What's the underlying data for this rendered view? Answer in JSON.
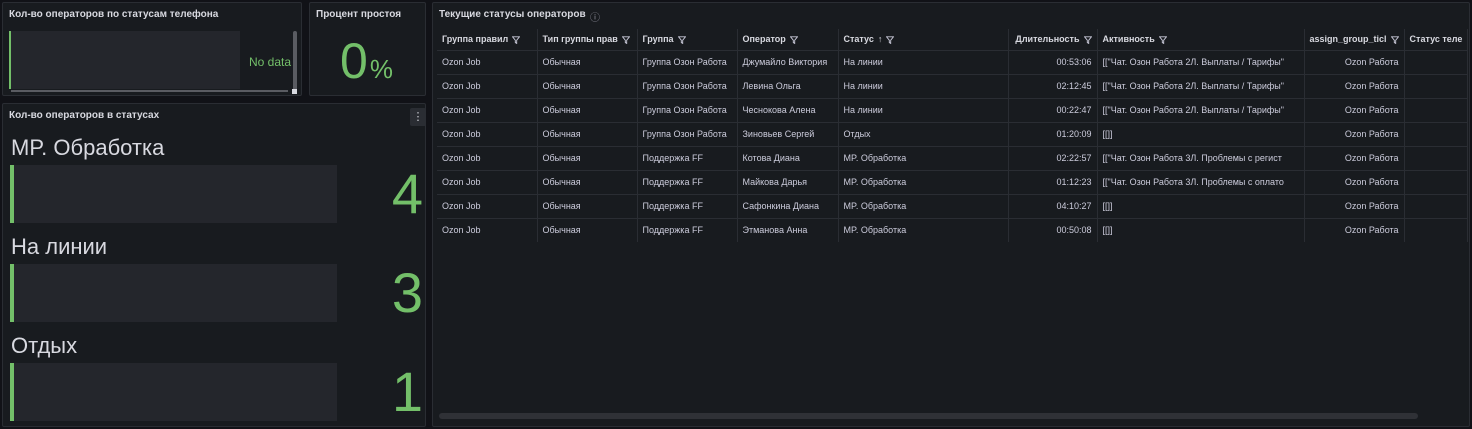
{
  "phone_panel": {
    "title": "Кол-во операторов по статусам телефона",
    "nodata": "No data"
  },
  "idle_panel": {
    "title": "Процент простоя",
    "value": "0",
    "unit": "%"
  },
  "status_panel": {
    "title": "Кол-во операторов в статусах",
    "menu_icon": "kebab-icon",
    "items": [
      {
        "label": "MP. Обработка",
        "value": "4"
      },
      {
        "label": "На линии",
        "value": "3"
      },
      {
        "label": "Отдых",
        "value": "1"
      }
    ]
  },
  "table_panel": {
    "title": "Текущие статусы операторов",
    "info_icon": "info-icon",
    "columns": [
      "Группа правил",
      "Тип группы прав",
      "Группа",
      "Оператор",
      "Статус",
      "Длительность",
      "Активность",
      "assign_group_ticl",
      "Статус теле"
    ],
    "rows": [
      [
        "Ozon Job",
        "Обычная",
        "Группа Озон Работа",
        "Джумайло Виктория",
        "На линии",
        "00:53:06",
        "[[\"Чат. Озон Работа 2Л. Выплаты / Тарифы\"",
        "Ozon Работа",
        ""
      ],
      [
        "Ozon Job",
        "Обычная",
        "Группа Озон Работа",
        "Левина Ольга",
        "На линии",
        "02:12:45",
        "[[\"Чат. Озон Работа 2Л. Выплаты / Тарифы\"",
        "Ozon Работа",
        ""
      ],
      [
        "Ozon Job",
        "Обычная",
        "Группа Озон Работа",
        "Чеснокова Алена",
        "На линии",
        "00:22:47",
        "[[\"Чат. Озон Работа 2Л. Выплаты / Тарифы\"",
        "Ozon Работа",
        ""
      ],
      [
        "Ozon Job",
        "Обычная",
        "Группа Озон Работа",
        "Зиновьев Сергей",
        "Отдых",
        "01:20:09",
        "[[]]",
        "Ozon Работа",
        ""
      ],
      [
        "Ozon Job",
        "Обычная",
        "Поддержка FF",
        "Котова Диана",
        "MP. Обработка",
        "02:22:57",
        "[[\"Чат. Озон Работа 3Л. Проблемы с регист",
        "Ozon Работа",
        ""
      ],
      [
        "Ozon Job",
        "Обычная",
        "Поддержка FF",
        "Майкова Дарья",
        "MP. Обработка",
        "01:12:23",
        "[[\"Чат. Озон Работа 3Л. Проблемы с оплато",
        "Ozon Работа",
        ""
      ],
      [
        "Ozon Job",
        "Обычная",
        "Поддержка FF",
        "Сафонкина Диана",
        "MP. Обработка",
        "04:10:27",
        "[[]]",
        "Ozon Работа",
        ""
      ],
      [
        "Ozon Job",
        "Обычная",
        "Поддержка FF",
        "Этманова Анна",
        "MP. Обработка",
        "00:50:08",
        "[[]]",
        "Ozon Работа",
        ""
      ]
    ]
  },
  "colors": {
    "accent": "#73bf69",
    "bg": "#111217",
    "panel": "#181b1f"
  }
}
